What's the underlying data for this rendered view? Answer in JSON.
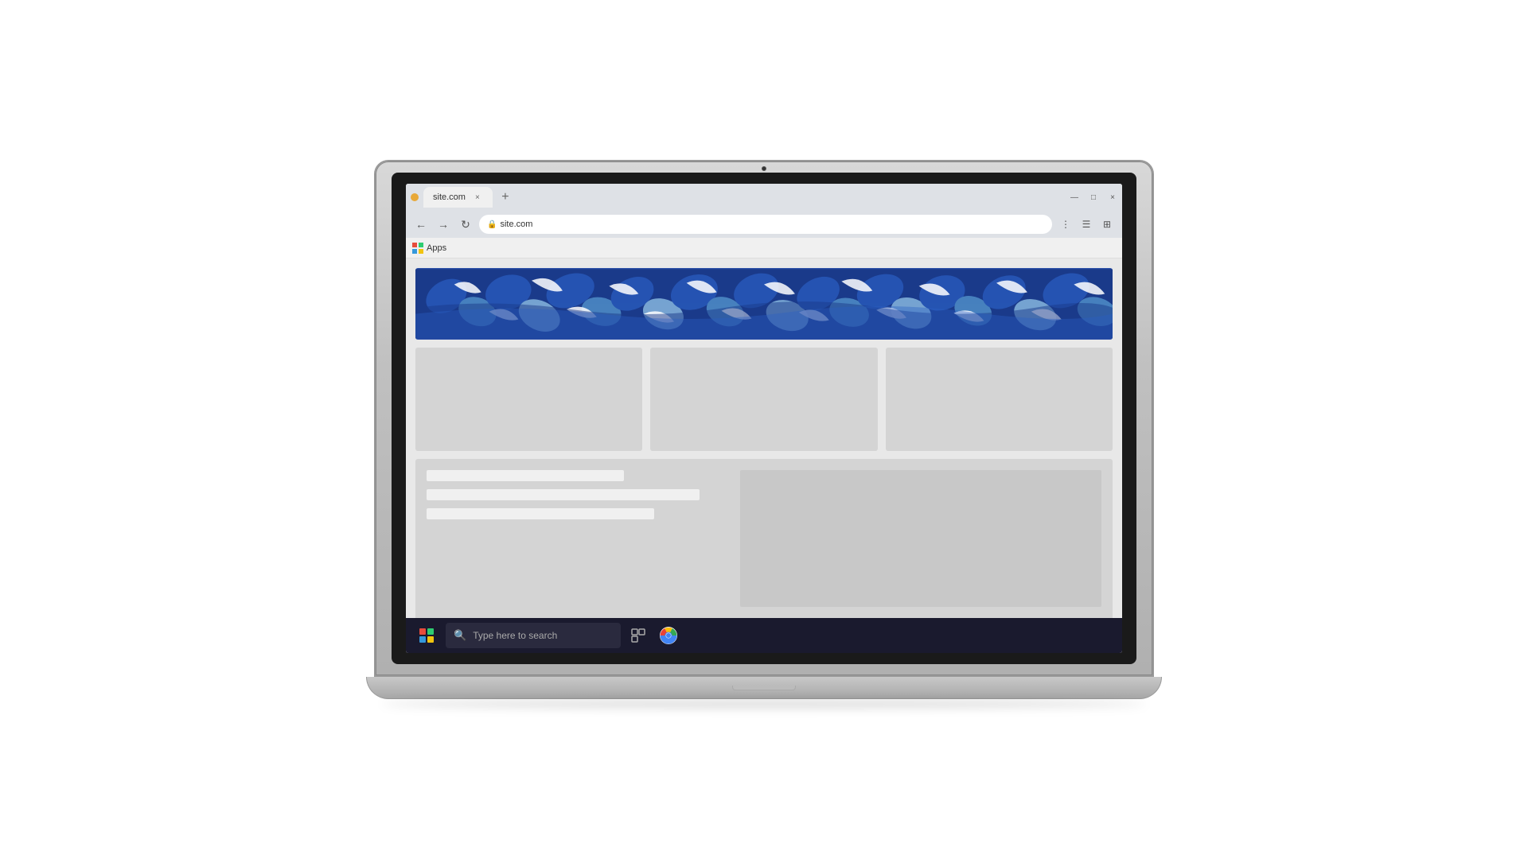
{
  "laptop": {
    "screen": {
      "browser": {
        "tab": {
          "label": "site.com",
          "close_icon": "×",
          "new_tab_icon": "+"
        },
        "window_controls": {
          "minimize": "—",
          "maximize": "□",
          "close": "×"
        },
        "address": {
          "url": "site.com",
          "back_icon": "←",
          "forward_icon": "→",
          "refresh_icon": "↻"
        },
        "bookmarks": {
          "label": "Apps"
        }
      },
      "site": {
        "hero_alt": "decorative blue floral pattern banner",
        "cards": [
          {
            "alt": "content card 1"
          },
          {
            "alt": "content card 2"
          },
          {
            "alt": "content card 3"
          }
        ],
        "content_lines": [
          {
            "width": "65%"
          },
          {
            "width": "90%"
          },
          {
            "width": "75%"
          }
        ]
      },
      "taskbar": {
        "start_tooltip": "Start",
        "search_placeholder": "Type here to search",
        "task_view_icon": "⊟",
        "chrome_tooltip": "Google Chrome"
      }
    }
  },
  "colors": {
    "hero_dark_blue": "#1a3a8a",
    "hero_mid_blue": "#2b5fc4",
    "hero_light_blue": "#5b9fd4",
    "hero_pale_blue": "#9dd0f0",
    "win_red": "#e74c3c",
    "win_green": "#2ecc71",
    "win_blue": "#3498db",
    "win_yellow": "#f1c40f",
    "taskbar_bg": "#1a1a2e",
    "card_bg": "#d4d4d4",
    "text_line_bg": "#f0f0f0"
  }
}
